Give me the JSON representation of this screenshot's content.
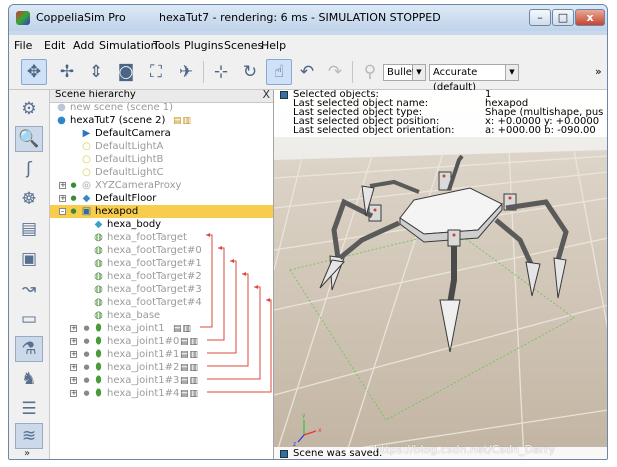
{
  "window": {
    "app_title": "CoppeliaSim Pro",
    "title_status": "hexaTut7 - rendering: 6 ms - SIMULATION STOPPED",
    "minimize_label": "–",
    "maximize_label": "□",
    "close_label": "x"
  },
  "menu": [
    "File",
    "Edit",
    "Add",
    "Simulation",
    "Tools",
    "Plugins",
    "Scenes",
    "Help"
  ],
  "toolbar": {
    "engine": "Bullet",
    "accuracy": "Accurate (default)",
    "overflow": "»"
  },
  "hierarchy": {
    "title": "Scene hierarchy",
    "close": "X",
    "items": [
      {
        "label": "new scene (scene 1)",
        "icon": "scene-icon"
      },
      {
        "label": "hexaTut7 (scene 2)",
        "icon": "scene-icon"
      },
      {
        "label": "DefaultCamera",
        "icon": "camera-icon"
      },
      {
        "label": "DefaultLightA",
        "icon": "light-icon"
      },
      {
        "label": "DefaultLightB",
        "icon": "light-icon"
      },
      {
        "label": "DefaultLightC",
        "icon": "light-icon"
      },
      {
        "label": "XYZCameraProxy",
        "icon": "dummy-icon"
      },
      {
        "label": "DefaultFloor",
        "icon": "shape-icon"
      },
      {
        "label": "hexapod",
        "icon": "model-icon"
      },
      {
        "label": "hexa_body",
        "icon": "shape-icon"
      },
      {
        "label": "hexa_footTarget",
        "icon": "dummy-icon"
      },
      {
        "label": "hexa_footTarget#0",
        "icon": "dummy-icon"
      },
      {
        "label": "hexa_footTarget#1",
        "icon": "dummy-icon"
      },
      {
        "label": "hexa_footTarget#2",
        "icon": "dummy-icon"
      },
      {
        "label": "hexa_footTarget#3",
        "icon": "dummy-icon"
      },
      {
        "label": "hexa_footTarget#4",
        "icon": "dummy-icon"
      },
      {
        "label": "hexa_base",
        "icon": "dummy-icon"
      },
      {
        "label": "hexa_joint1",
        "icon": "joint-icon"
      },
      {
        "label": "hexa_joint1#0",
        "icon": "joint-icon"
      },
      {
        "label": "hexa_joint1#1",
        "icon": "joint-icon"
      },
      {
        "label": "hexa_joint1#2",
        "icon": "joint-icon"
      },
      {
        "label": "hexa_joint1#3",
        "icon": "joint-icon"
      },
      {
        "label": "hexa_joint1#4",
        "icon": "joint-icon"
      }
    ]
  },
  "info": {
    "rows": [
      {
        "key": "Selected objects:",
        "value": "1"
      },
      {
        "key": "Last selected object name:",
        "value": "hexapod"
      },
      {
        "key": "Last selected object type:",
        "value": "Shape (multishape, pus"
      },
      {
        "key": "Last selected object position:",
        "value": "x: +0.0000   y: +0.0000"
      },
      {
        "key": "Last selected object orientation:",
        "value": "a: +000.00   b: -090.00"
      }
    ]
  },
  "status": "Scene was saved.",
  "watermark": "https://blog.csdn.net/Csdn_Darry",
  "colors": {
    "selection": "#f8cc4c",
    "link_lines": "#d94a3a",
    "floor": "#cfc3b3"
  }
}
